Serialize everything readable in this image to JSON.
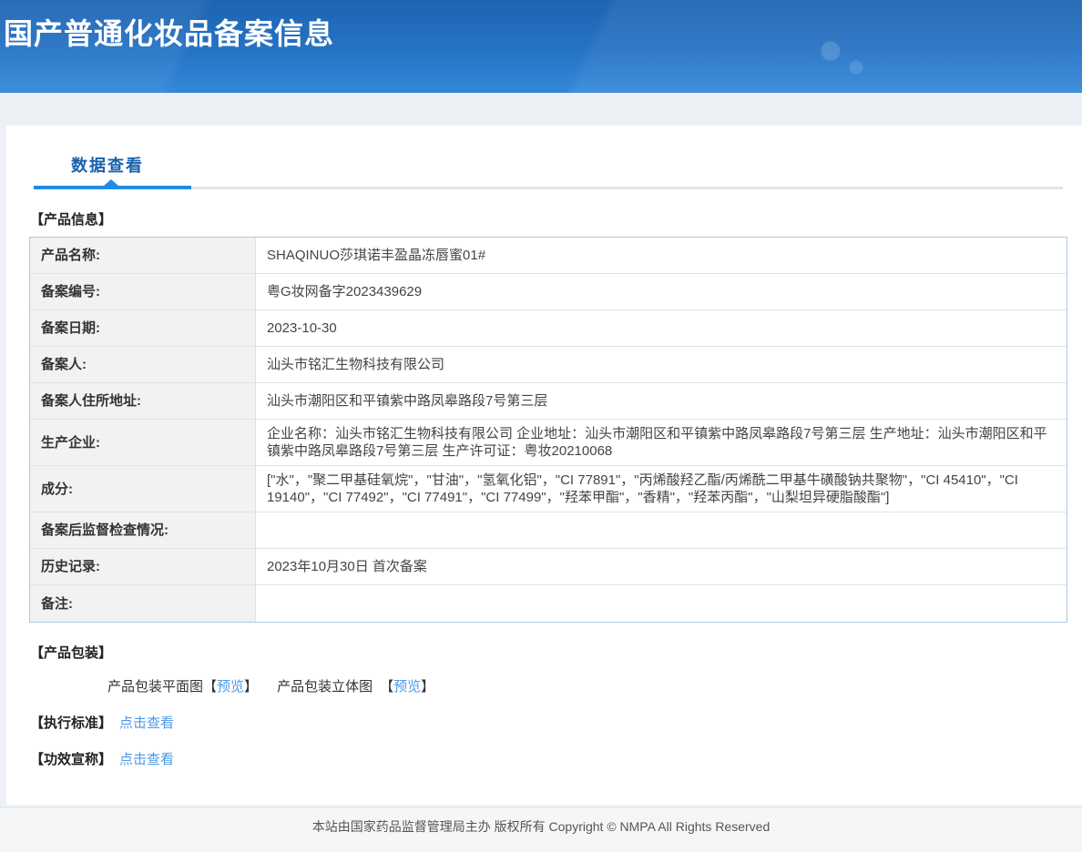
{
  "header": {
    "title": "国产普通化妆品备案信息"
  },
  "tabs": {
    "data_view": "数据查看"
  },
  "product_info": {
    "section_title": "【产品信息】",
    "rows": [
      {
        "label": "产品名称:",
        "value": "SHAQINUO莎琪诺丰盈晶冻唇蜜01#"
      },
      {
        "label": "备案编号:",
        "value": "粤G妆网备字2023439629"
      },
      {
        "label": "备案日期:",
        "value": "2023-10-30"
      },
      {
        "label": "备案人:",
        "value": "汕头市铭汇生物科技有限公司"
      },
      {
        "label": "备案人住所地址:",
        "value": "汕头市潮阳区和平镇紫中路凤皋路段7号第三层"
      },
      {
        "label": "生产企业:",
        "value": "企业名称：汕头市铭汇生物科技有限公司 企业地址：汕头市潮阳区和平镇紫中路凤皋路段7号第三层 生产地址：汕头市潮阳区和平镇紫中路凤皋路段7号第三层 生产许可证：粤妆20210068"
      },
      {
        "label": "成分:",
        "value": "[\"水\"，\"聚二甲基硅氧烷\"，\"甘油\"，\"氢氧化铝\"，\"CI 77891\"，\"丙烯酸羟乙酯/丙烯酰二甲基牛磺酸钠共聚物\"，\"CI 45410\"，\"CI 19140\"，\"CI 77492\"，\"CI 77491\"，\"CI 77499\"，\"羟苯甲酯\"，\"香精\"，\"羟苯丙酯\"，\"山梨坦异硬脂酸酯\"]"
      },
      {
        "label": "备案后监督检查情况:",
        "value": ""
      },
      {
        "label": "历史记录:",
        "value": "2023年10月30日 首次备案"
      },
      {
        "label": "备注:",
        "value": ""
      }
    ]
  },
  "packaging": {
    "section_title": "【产品包装】",
    "flat_label": "产品包装平面图",
    "stereo_label": "产品包装立体图",
    "bracket_open": "【",
    "bracket_close": "】",
    "preview_link": "预览"
  },
  "exec_standard": {
    "label": "【执行标准】",
    "link": "点击查看"
  },
  "efficacy_claim": {
    "label": "【功效宣称】",
    "link": "点击查看"
  },
  "footer": {
    "text": "本站由国家药品监督管理局主办 版权所有 Copyright © NMPA All Rights Reserved"
  },
  "colors": {
    "banner_top": "#1e64b2",
    "banner_bottom": "#3488da",
    "tab_text": "#1761ad",
    "tab_underline": "#1f8ce6",
    "link": "#4d9ae6",
    "table_outer_border": "#a9c7e7",
    "table_inner_border": "#e2e2e2",
    "label_cell_bg": "#f2f2f2",
    "page_bg": "#edf1f6",
    "footer_bg": "#f5f6f8"
  }
}
